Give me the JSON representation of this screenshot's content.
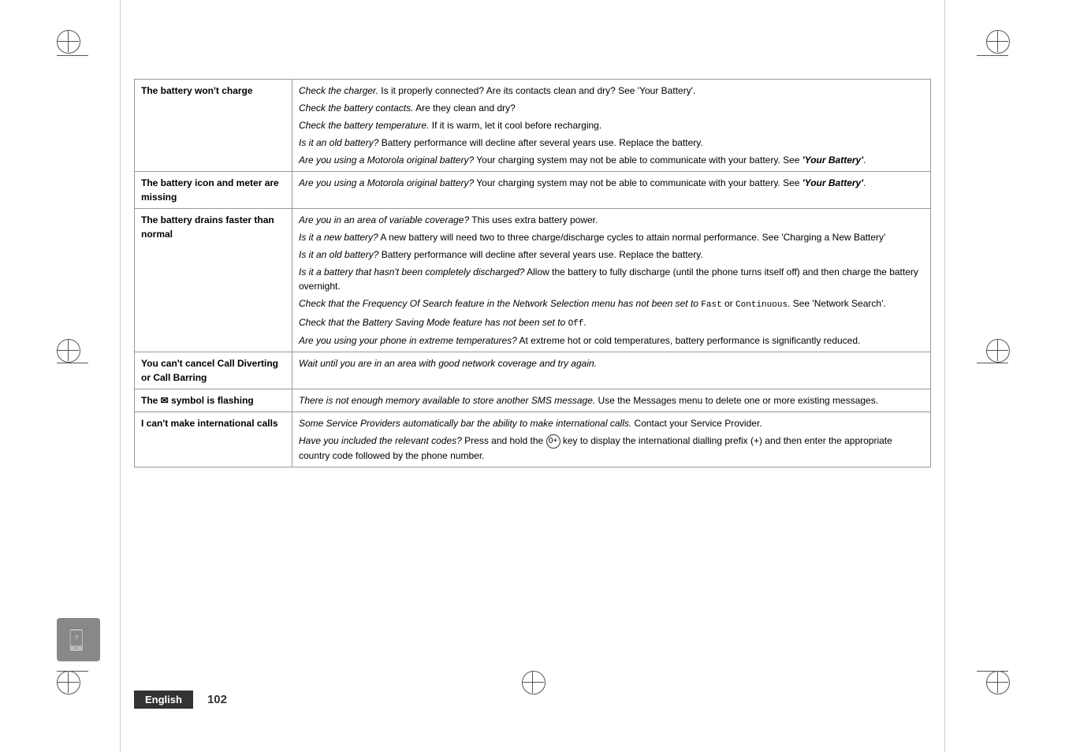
{
  "page": {
    "language": "English",
    "page_number": "102"
  },
  "table": {
    "rows": [
      {
        "issue": "The battery won't charge",
        "solutions": [
          "Check the charger. Is it properly connected? Are its contacts clean and dry? See 'Your Battery'.",
          "Check the battery contacts. Are they clean and dry?",
          "Check the battery temperature. If it is warm, let it cool before recharging.",
          "Is it an old battery? Battery performance will decline after several years use. Replace the battery.",
          "Are you using a Motorola original battery? Your charging system may not be able to communicate with your battery. See 'Your Battery'."
        ]
      },
      {
        "issue": "The battery icon and meter are missing",
        "solutions": [
          "Are you using a Motorola original battery? Your charging system may not be able to communicate with your battery. See 'Your Battery'."
        ]
      },
      {
        "issue": "The battery drains faster than normal",
        "solutions": [
          "Are you in an area of variable coverage? This uses extra battery power.",
          "Is it a new battery? A new battery will need two to three charge/discharge cycles to attain normal performance. See 'Charging a New Battery'",
          "Is it an old battery? Battery performance will decline after several years use. Replace the battery.",
          "Is it a battery that hasn't been completely discharged? Allow the battery to fully discharge (until the phone turns itself off) and then charge the battery overnight.",
          "Check that the Frequency Of Search feature in the Network Selection menu has not been set to Fast or Continuous. See 'Network Search'.",
          "Check that the Battery Saving Mode feature has not been set to Off.",
          "Are you using your phone in extreme temperatures? At extreme hot or cold temperatures, battery performance is significantly reduced."
        ]
      },
      {
        "issue": "You can't cancel Call Diverting or Call Barring",
        "solutions": [
          "Wait until you are in an area with good network coverage and try again."
        ]
      },
      {
        "issue": "The ✉ symbol is flashing",
        "solutions": [
          "There is not enough memory available to store another SMS message. Use the Messages menu to delete one or more existing messages."
        ]
      },
      {
        "issue": "I can't make international calls",
        "solutions": [
          "Some Service Providers automatically bar the ability to make international calls. Contact your Service Provider.",
          "Have you included the relevant codes? Press and hold the 0+ key to display the international dialling prefix (+) and then enter the appropriate country code followed by the phone number."
        ]
      }
    ]
  }
}
